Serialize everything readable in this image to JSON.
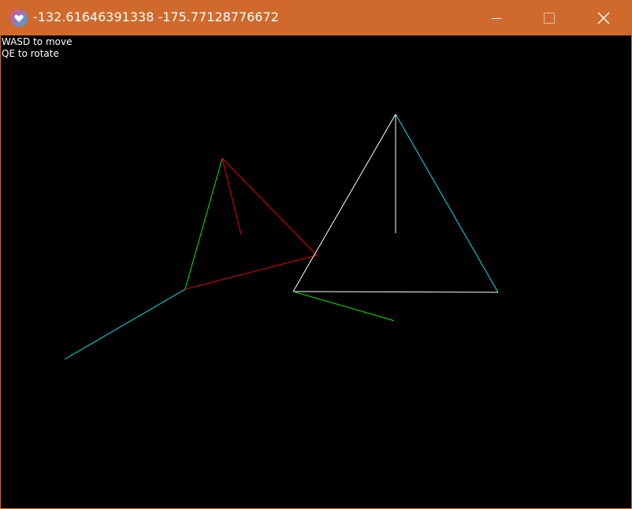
{
  "window": {
    "title": "-132.61646391338 -175.77128776672",
    "titlebar_color": "#cf6a2c",
    "background": "#000000"
  },
  "hints": {
    "move": "WASD to move",
    "rotate": "QE to rotate"
  },
  "controls": {
    "minimize_icon": "minimize-icon",
    "maximize_icon": "maximize-icon",
    "close_icon": "close-icon"
  },
  "scene_colors": {
    "white": "#ffffff",
    "cyan": "#00e5ee",
    "green": "#00ee00",
    "red": "#ee0000"
  }
}
